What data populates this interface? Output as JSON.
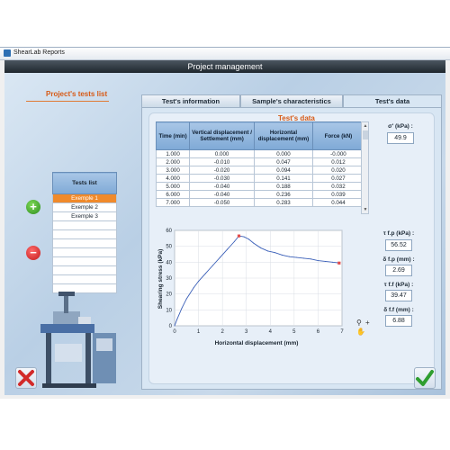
{
  "window": {
    "title": "ShearLab Reports"
  },
  "header": {
    "title": "Project management"
  },
  "left": {
    "section_title": "Project's tests list",
    "tests_header": "Tests list",
    "tests": [
      "Exemple 1",
      "Exemple 2",
      "Exemple 3",
      "",
      "",
      "",
      "",
      "",
      "",
      "",
      ""
    ],
    "selected_index": 0,
    "add_symbol": "+",
    "remove_symbol": "−"
  },
  "tabs": [
    "Test's information",
    "Sample's characteristics",
    "Test's data"
  ],
  "active_tab": 2,
  "data_panel": {
    "section_title": "Test's data",
    "columns": [
      "Time (min)",
      "Vertical displacement / Settlement (mm)",
      "Horizontal displacement (mm)",
      "Force (kN)"
    ],
    "rows": [
      [
        "1.000",
        "0.000",
        "0.000",
        "-0.000"
      ],
      [
        "2.000",
        "-0.010",
        "0.047",
        "0.012"
      ],
      [
        "3.000",
        "-0.020",
        "0.094",
        "0.020"
      ],
      [
        "4.000",
        "-0.030",
        "0.141",
        "0.027"
      ],
      [
        "5.000",
        "-0.040",
        "0.188",
        "0.032"
      ],
      [
        "6.000",
        "-0.040",
        "0.236",
        "0.039"
      ],
      [
        "7.000",
        "-0.050",
        "0.283",
        "0.044"
      ]
    ],
    "sigma_label": "σ' (kPa) :",
    "sigma_value": "49.9",
    "results": [
      {
        "label": "τ f.p (kPa) :",
        "value": "56.52"
      },
      {
        "label": "δ f.p (mm) :",
        "value": "2.69"
      },
      {
        "label": "τ f.f (kPa) :",
        "value": "39.47"
      },
      {
        "label": "δ f.f (mm) :",
        "value": "6.88"
      }
    ]
  },
  "chart_data": {
    "type": "line",
    "xlabel": "Horizontal displacement (mm)",
    "ylabel": "Shearing stress (kPa)",
    "xlim": [
      0,
      7
    ],
    "ylim": [
      0,
      60
    ],
    "xticks": [
      "0",
      "1",
      "2",
      "3",
      "4",
      "5",
      "6",
      "7"
    ],
    "yticks": [
      "0",
      "10",
      "20",
      "30",
      "40",
      "50",
      "60"
    ],
    "grid": true,
    "series": [
      {
        "x": [
          0,
          0.1,
          0.3,
          0.5,
          0.8,
          1.0,
          1.3,
          1.6,
          1.9,
          2.2,
          2.5,
          2.69,
          2.9,
          3.1,
          3.3,
          3.6,
          3.9,
          4.2,
          4.5,
          4.8,
          5.1,
          5.4,
          5.7,
          6.0,
          6.3,
          6.6,
          6.88
        ],
        "y": [
          0,
          4,
          11,
          17,
          24,
          28,
          33,
          38,
          43,
          48,
          53,
          56.5,
          56,
          54.5,
          52,
          49,
          47,
          46,
          44.5,
          43.5,
          43,
          42.5,
          42,
          41,
          40.5,
          40,
          39.5
        ],
        "color": "#3a5fb8"
      }
    ],
    "markers": [
      {
        "x": 2.69,
        "y": 56.52
      },
      {
        "x": 6.88,
        "y": 39.47
      }
    ]
  },
  "colors": {
    "accent": "#d75a16",
    "header_dark": "#2a333b",
    "selection": "#f08a2b"
  }
}
